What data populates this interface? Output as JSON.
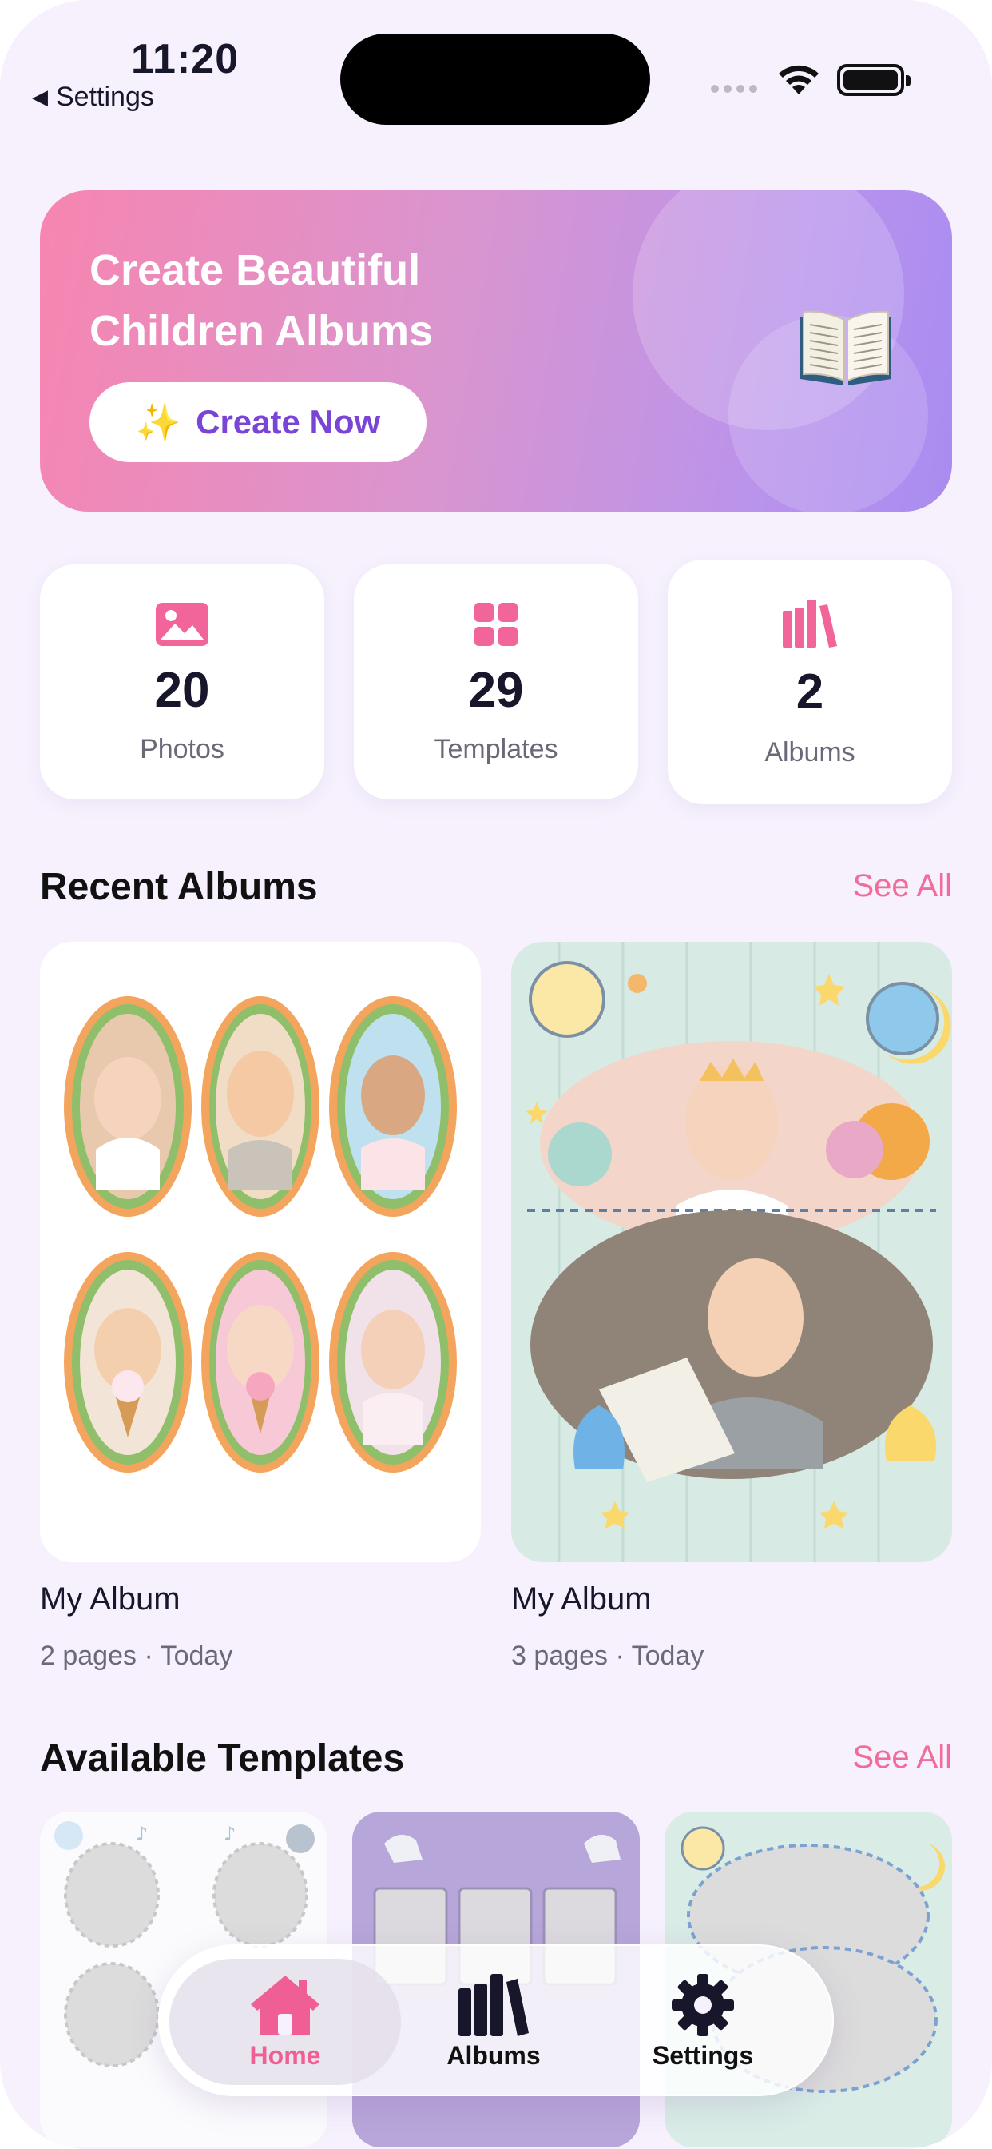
{
  "status_bar": {
    "time": "11:20",
    "back_label": "Settings"
  },
  "hero": {
    "title_line1": "Create Beautiful",
    "title_line2": "Children Albums",
    "button_label": "Create Now",
    "button_icon": "sparkles-icon",
    "decor_icon": "open-book-icon"
  },
  "stats": [
    {
      "icon": "photo-icon",
      "value": "20",
      "label": "Photos"
    },
    {
      "icon": "grid-icon",
      "value": "29",
      "label": "Templates"
    },
    {
      "icon": "books-icon",
      "value": "2",
      "label": "Albums"
    }
  ],
  "recent_albums": {
    "title": "Recent Albums",
    "see_all": "See All",
    "items": [
      {
        "name": "My Album",
        "meta": "2 pages · Today"
      },
      {
        "name": "My Album",
        "meta": "3 pages · Today"
      }
    ]
  },
  "templates": {
    "title": "Available Templates",
    "see_all": "See All"
  },
  "tab_bar": {
    "active": "Home",
    "items": [
      {
        "label": "Home",
        "icon": "house-icon"
      },
      {
        "label": "Albums",
        "icon": "books-icon"
      },
      {
        "label": "Settings",
        "icon": "gear-icon"
      }
    ]
  },
  "colors": {
    "accent_pink": "#ef5f95",
    "accent_purple": "#7a45d6",
    "background": "#f6f1fd",
    "hero_gradient_start": "#f785b0",
    "hero_gradient_end": "#a98cf1"
  }
}
